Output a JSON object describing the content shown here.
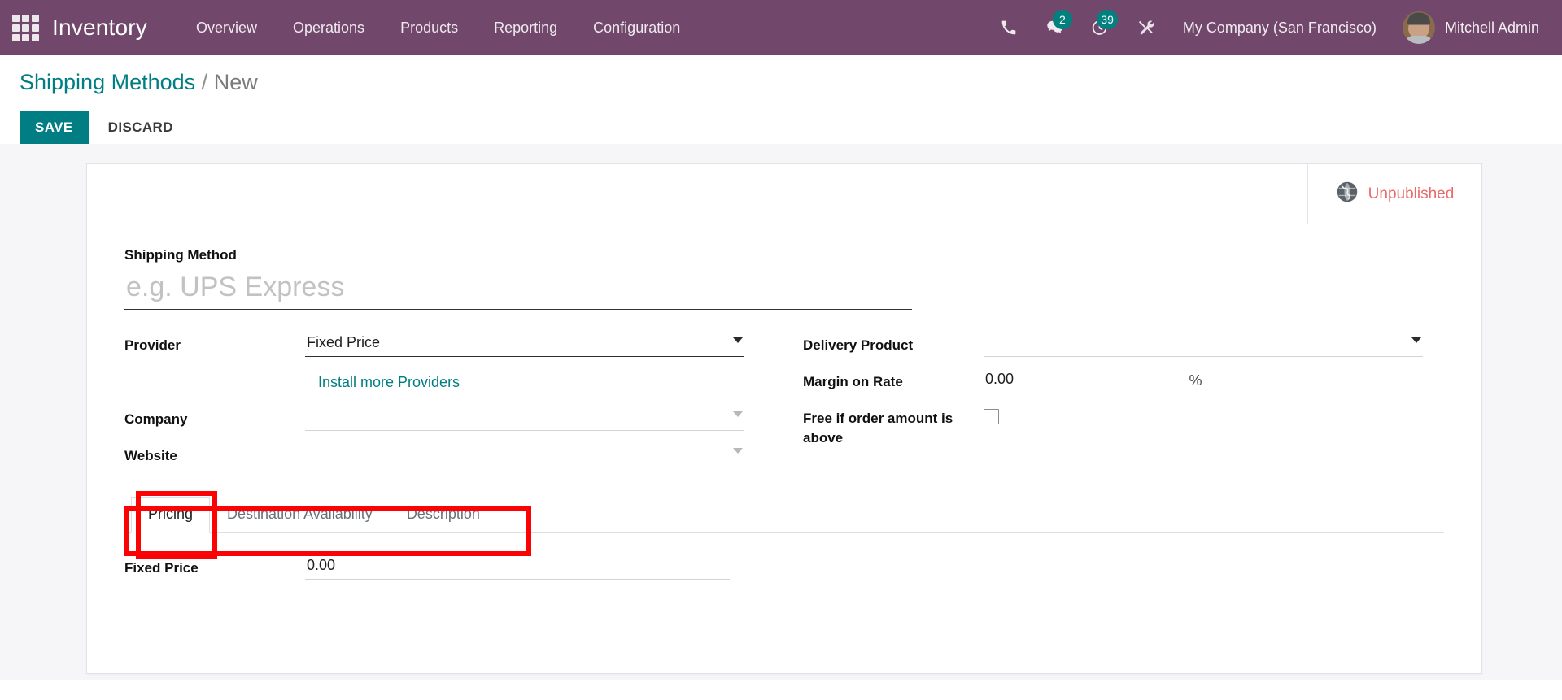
{
  "navbar": {
    "apps_icon": "apps-grid-icon",
    "brand": "Inventory",
    "menu": [
      {
        "label": "Overview"
      },
      {
        "label": "Operations"
      },
      {
        "label": "Products"
      },
      {
        "label": "Reporting"
      },
      {
        "label": "Configuration"
      }
    ],
    "icons": [
      {
        "name": "phone-icon",
        "badge": null
      },
      {
        "name": "messages-icon",
        "badge": "2"
      },
      {
        "name": "activities-clock-icon",
        "badge": "39"
      },
      {
        "name": "developer-tools-icon",
        "badge": null
      }
    ],
    "company": "My Company (San Francisco)",
    "user": "Mitchell Admin"
  },
  "control_panel": {
    "breadcrumb_root": "Shipping Methods",
    "breadcrumb_sep": "/",
    "breadcrumb_current": "New",
    "save_label": "SAVE",
    "discard_label": "DISCARD"
  },
  "statusbar": {
    "globe_icon": "globe-icon",
    "publish_state": "Unpublished"
  },
  "form": {
    "title_label": "Shipping Method",
    "title_value": "",
    "title_placeholder": "e.g. UPS Express",
    "left": {
      "provider_label": "Provider",
      "provider_value": "Fixed Price",
      "install_providers_link": "Install more Providers",
      "company_label": "Company",
      "company_value": "",
      "website_label": "Website",
      "website_value": ""
    },
    "right": {
      "delivery_product_label": "Delivery Product",
      "delivery_product_value": "",
      "margin_label": "Margin on Rate",
      "margin_value": "0.00",
      "margin_suffix": "%",
      "free_if_above_label": "Free if order amount is above",
      "free_if_above_checked": false
    }
  },
  "notebook": {
    "tabs": [
      {
        "label": "Pricing",
        "active": true
      },
      {
        "label": "Destination Availability",
        "active": false
      },
      {
        "label": "Description",
        "active": false
      }
    ],
    "pricing_pane": {
      "fixed_price_label": "Fixed Price",
      "fixed_price_value": "0.00"
    }
  },
  "annotations": [
    {
      "name": "highlight-box-tabs"
    },
    {
      "name": "highlight-box-pricing-tab"
    }
  ],
  "colors": {
    "navbar_purple": "#71486B",
    "accent_teal": "#017E84",
    "unpublished_red": "#e96a6a",
    "annotation_red": "#fb0304",
    "page_bg": "#f6f6f8"
  }
}
